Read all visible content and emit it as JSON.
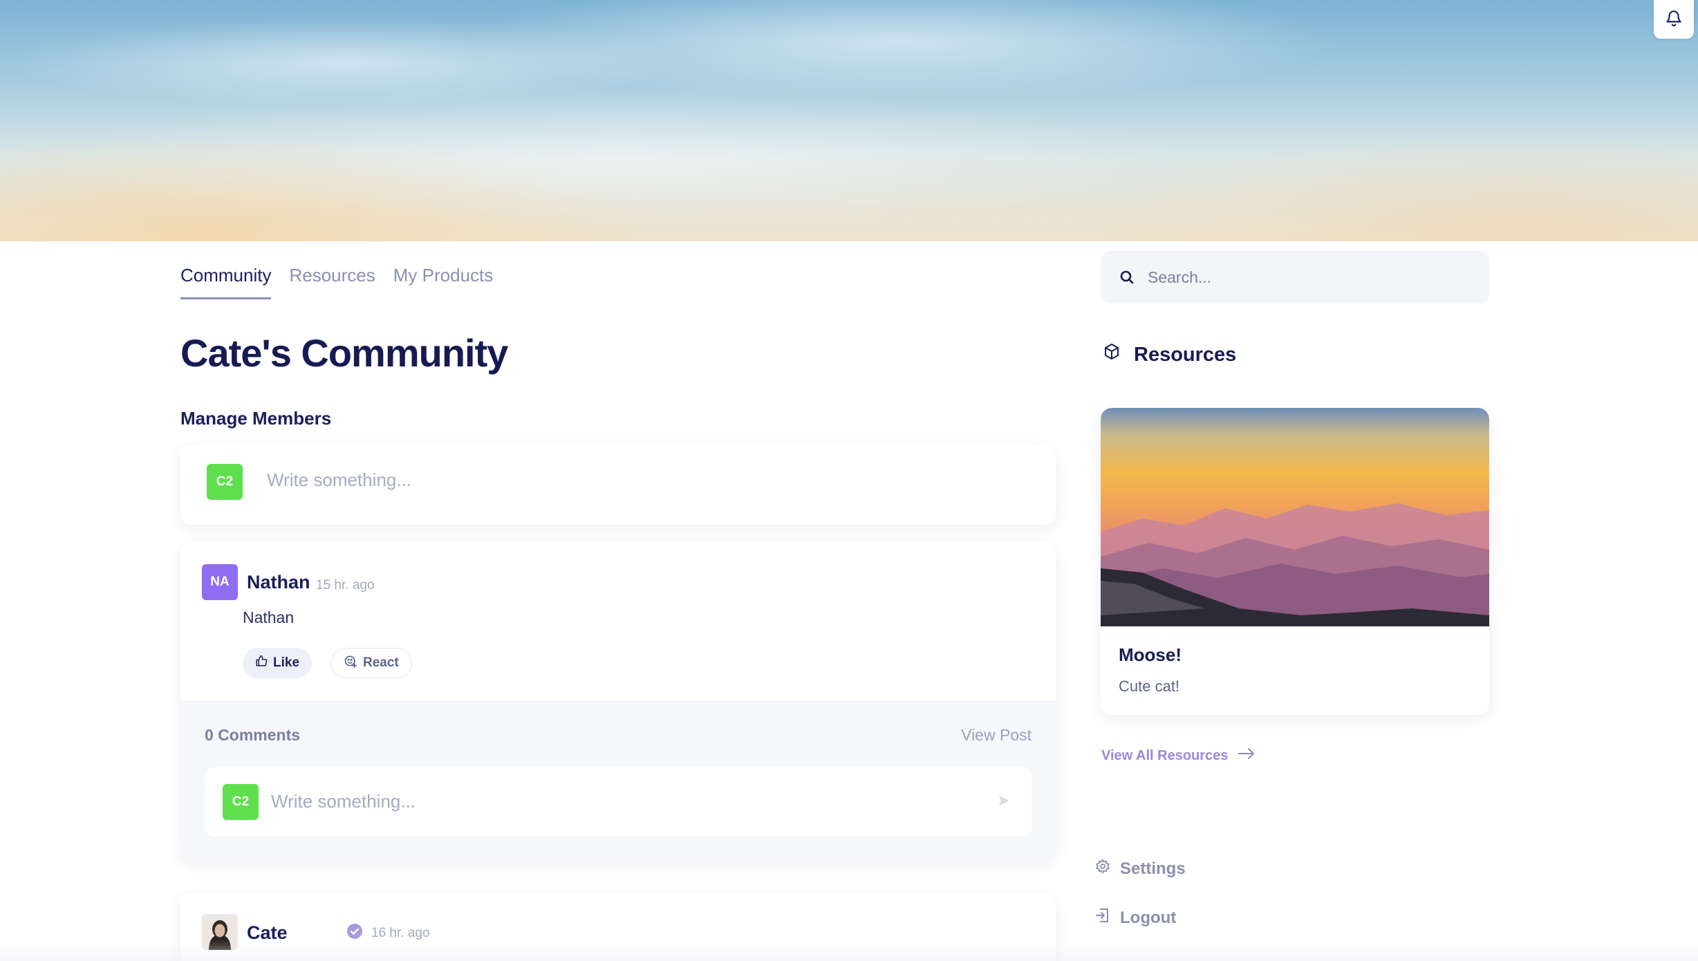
{
  "notifications": {
    "icon": "bell-icon"
  },
  "tabs": [
    {
      "label": "Community",
      "active": true
    },
    {
      "label": "Resources",
      "active": false
    },
    {
      "label": "My Products",
      "active": false
    }
  ],
  "page_title": "Cate's Community",
  "manage_members": "Manage Members",
  "composer": {
    "avatar_initials": "C2",
    "placeholder": "Write something..."
  },
  "post": {
    "avatar_initials": "NA",
    "author": "Nathan",
    "time": "15 hr. ago",
    "body": "Nathan",
    "like_label": "Like",
    "react_label": "React",
    "comments_count": "0 Comments",
    "view_post": "View Post",
    "comment_avatar_initials": "C2",
    "comment_placeholder": "Write something..."
  },
  "post2": {
    "author": "Cate",
    "time": "16 hr. ago"
  },
  "search": {
    "placeholder": "Search..."
  },
  "resources": {
    "heading": "Resources",
    "card_title": "Moose!",
    "card_description": "Cute cat!",
    "view_all": "View All Resources"
  },
  "sidebar_links": {
    "settings": "Settings",
    "logout": "Logout"
  },
  "colors": {
    "primary_text": "#161b54",
    "muted_text": "#8a90b3",
    "accent_purple": "#8f6cf0",
    "accent_green": "#5ee04d",
    "link_purple": "#9a87d8"
  }
}
